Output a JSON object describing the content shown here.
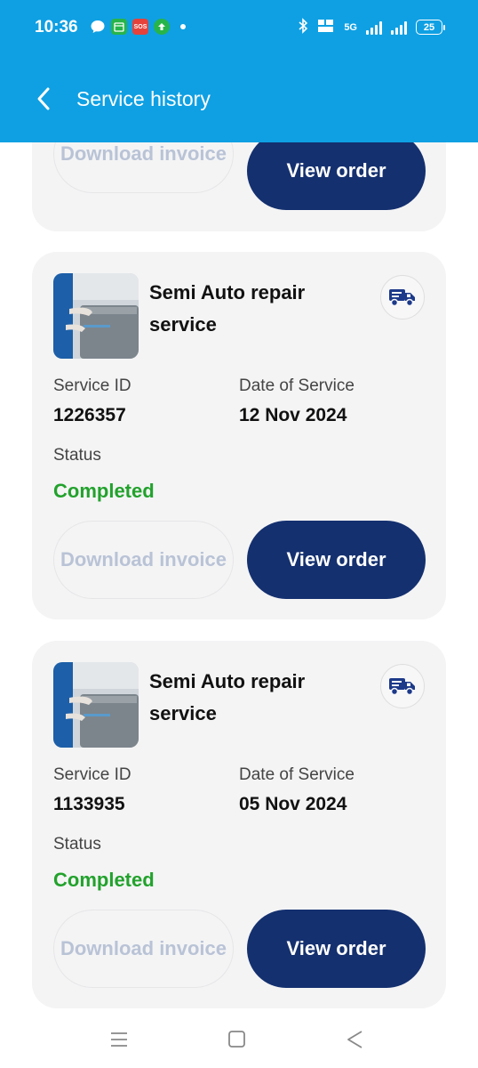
{
  "status_bar": {
    "time": "10:36",
    "notif_1": "",
    "notif_2": "SOS",
    "network_label": "5G",
    "battery": "25"
  },
  "header": {
    "title": "Service history",
    "back_icon": "chevron-left-icon"
  },
  "colors": {
    "header_bg": "#0fa0e3",
    "primary_button": "#14306f",
    "status_completed": "#22a22c",
    "card_bg": "#f4f4f5"
  },
  "previous_card": {
    "download_label": "Download invoice",
    "view_label": "View order"
  },
  "orders": [
    {
      "service_name": "Semi Auto repair service",
      "service_id_label": "Service ID",
      "service_id": "1226357",
      "date_label": "Date of Service",
      "date": "12 Nov 2024",
      "status_label": "Status",
      "status": "Completed",
      "download_label": "Download invoice",
      "view_label": "View order",
      "icon": "delivery-truck-icon"
    },
    {
      "service_name": "Semi Auto repair service",
      "service_id_label": "Service ID",
      "service_id": "1133935",
      "date_label": "Date of Service",
      "date": "05 Nov 2024",
      "status_label": "Status",
      "status": "Completed",
      "download_label": "Download invoice",
      "view_label": "View order",
      "icon": "delivery-truck-icon"
    }
  ],
  "nav": {
    "menu_icon": "menu-icon",
    "home_icon": "home-square-icon",
    "back_icon": "back-triangle-icon"
  }
}
